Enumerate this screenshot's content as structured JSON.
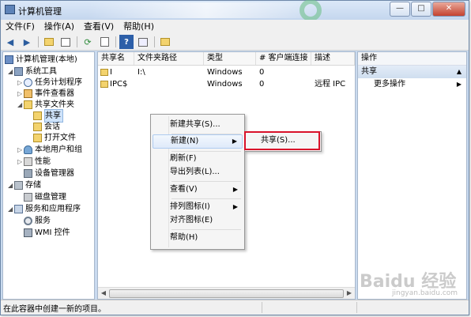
{
  "window": {
    "title": "计算机管理",
    "controls": {
      "minimize": "—",
      "maximize": "□",
      "close": "✕"
    }
  },
  "menubar": {
    "items": [
      "文件(F)",
      "操作(A)",
      "查看(V)",
      "帮助(H)"
    ]
  },
  "toolbar": {
    "icons": [
      "back-arrow-icon",
      "forward-arrow-icon",
      "up-folder-icon",
      "show-tree-icon",
      "refresh-icon",
      "export-icon",
      "help-icon",
      "properties-icon",
      "share-icon"
    ]
  },
  "tree": {
    "items": [
      {
        "label": "计算机管理(本地)",
        "icon": "computer-icon",
        "expanded": true
      },
      {
        "label": "系统工具",
        "icon": "tools-icon",
        "expanded": true
      },
      {
        "label": "任务计划程序",
        "icon": "clock-icon",
        "expanded": false
      },
      {
        "label": "事件查看器",
        "icon": "event-viewer-icon",
        "expanded": false
      },
      {
        "label": "共享文件夹",
        "icon": "shared-folder-icon",
        "expanded": true
      },
      {
        "label": "共享",
        "icon": "share-icon",
        "selected": true
      },
      {
        "label": "会话",
        "icon": "session-icon"
      },
      {
        "label": "打开文件",
        "icon": "open-file-icon"
      },
      {
        "label": "本地用户和组",
        "icon": "users-icon",
        "expanded": false
      },
      {
        "label": "性能",
        "icon": "performance-icon",
        "expanded": false
      },
      {
        "label": "设备管理器",
        "icon": "device-manager-icon"
      },
      {
        "label": "存储",
        "icon": "storage-icon",
        "expanded": true
      },
      {
        "label": "磁盘管理",
        "icon": "disk-icon"
      },
      {
        "label": "服务和应用程序",
        "icon": "services-apps-icon",
        "expanded": true
      },
      {
        "label": "服务",
        "icon": "gear-icon"
      },
      {
        "label": "WMI 控件",
        "icon": "wmi-icon"
      }
    ]
  },
  "list": {
    "columns": [
      "共享名",
      "文件夹路径",
      "类型",
      "# 客户端连接",
      "描述"
    ],
    "rows": [
      {
        "name": "I",
        "path": "I:\\",
        "type": "Windows",
        "clients": "0",
        "description": ""
      },
      {
        "name": "IPC$",
        "path": "",
        "type": "Windows",
        "clients": "0",
        "description": "远程 IPC"
      }
    ]
  },
  "actions": {
    "header": "操作",
    "section": "共享",
    "items": [
      "更多操作"
    ]
  },
  "context_menu": {
    "items": [
      {
        "label": "新建共享(S)...",
        "submenu": false
      },
      {
        "label": "新建(N)",
        "submenu": true,
        "highlighted": true
      },
      {
        "label": "刷新(F)",
        "submenu": false
      },
      {
        "label": "导出列表(L)...",
        "submenu": false
      },
      {
        "label": "查看(V)",
        "submenu": true
      },
      {
        "label": "排列图标(I)",
        "submenu": true
      },
      {
        "label": "对齐图标(E)",
        "submenu": false
      },
      {
        "label": "帮助(H)",
        "submenu": false
      }
    ],
    "submenu_item": "共享(S)..."
  },
  "statusbar": {
    "text": "在此容器中创建一新的项目。"
  },
  "watermark": {
    "text": "Baidu 经验",
    "sub": "jingyan.baidu.com"
  },
  "colors": {
    "highlight_box": "#d9122a",
    "title_gradient_top": "#dbe8f8",
    "selection": "#cfe3fa"
  }
}
